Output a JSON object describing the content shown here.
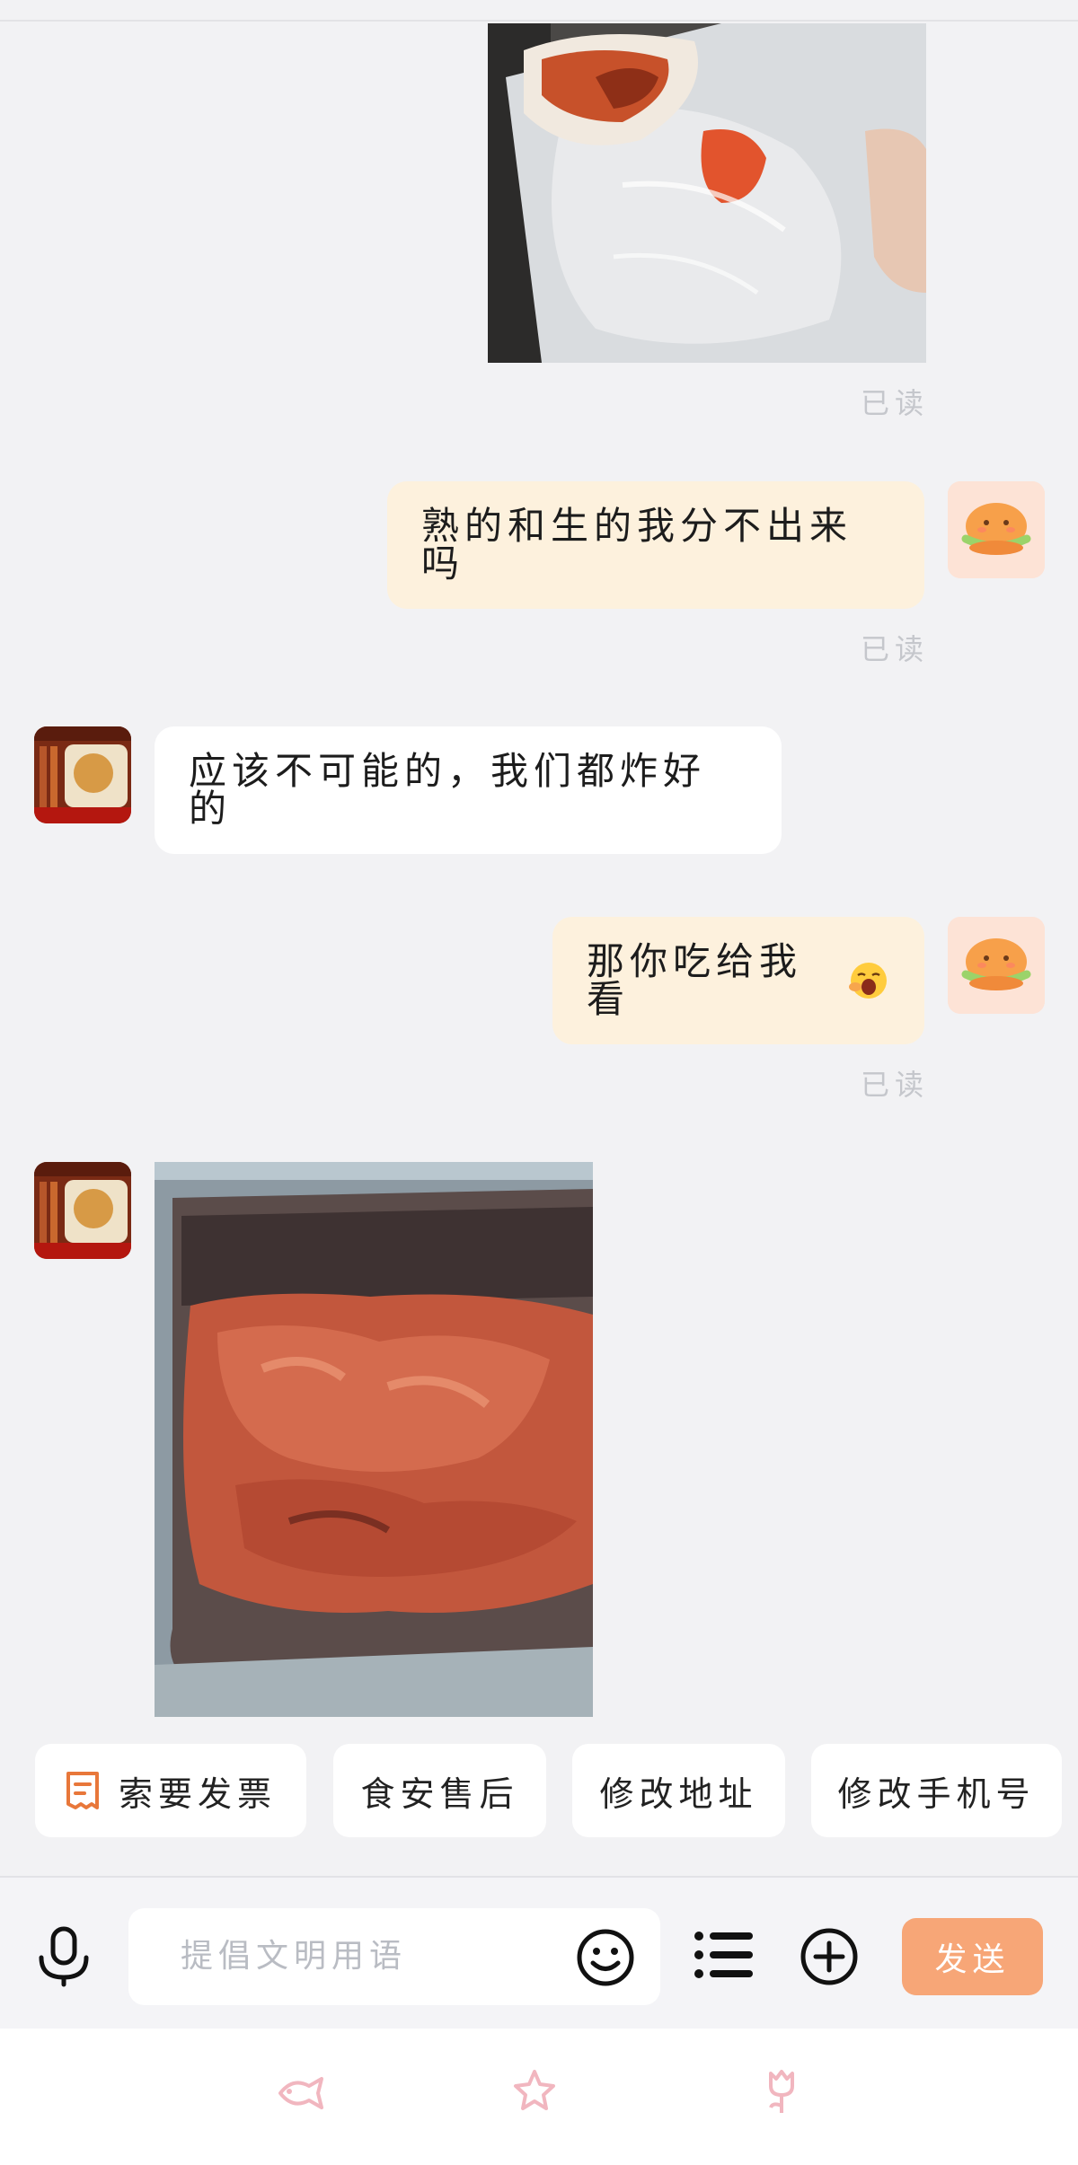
{
  "messages": [
    {
      "type": "image",
      "from": "me",
      "content": "spring-roll-photo"
    },
    {
      "type": "read_receipt",
      "text": "已读"
    },
    {
      "type": "text",
      "from": "me",
      "text": "熟的和生的我分不出来吗"
    },
    {
      "type": "read_receipt",
      "text": "已读"
    },
    {
      "type": "text",
      "from": "them",
      "text": "应该不可能的，我们都炸好的"
    },
    {
      "type": "text",
      "from": "me",
      "text": "那你吃给我看"
    },
    {
      "type": "read_receipt",
      "text": "已读"
    },
    {
      "type": "image",
      "from": "them",
      "content": "fried-meat-photo"
    }
  ],
  "read_label": "已读",
  "msg1_text": "熟的和生的我分不出来吗",
  "msg2_text": "应该不可能的，我们都炸好的",
  "msg3_text": "那你吃给我看",
  "quick_actions": {
    "invoice": "索要发票",
    "food_safety": "食安售后",
    "change_address": "修改地址",
    "change_phone": "修改手机号"
  },
  "input": {
    "placeholder": "提倡文明用语",
    "send_label": "发送"
  },
  "icons": {
    "voice": "microphone-icon",
    "emoji": "smiley-icon",
    "menu": "list-icon",
    "plus": "plus-circle-icon",
    "nav": [
      "fish-icon",
      "star-icon",
      "flower-icon"
    ]
  },
  "colors": {
    "my_bubble": "#fdf1dd",
    "their_bubble": "#ffffff",
    "send_button": "#f7a677",
    "accent_orange": "#e8773a",
    "background": "#f2f2f4"
  }
}
